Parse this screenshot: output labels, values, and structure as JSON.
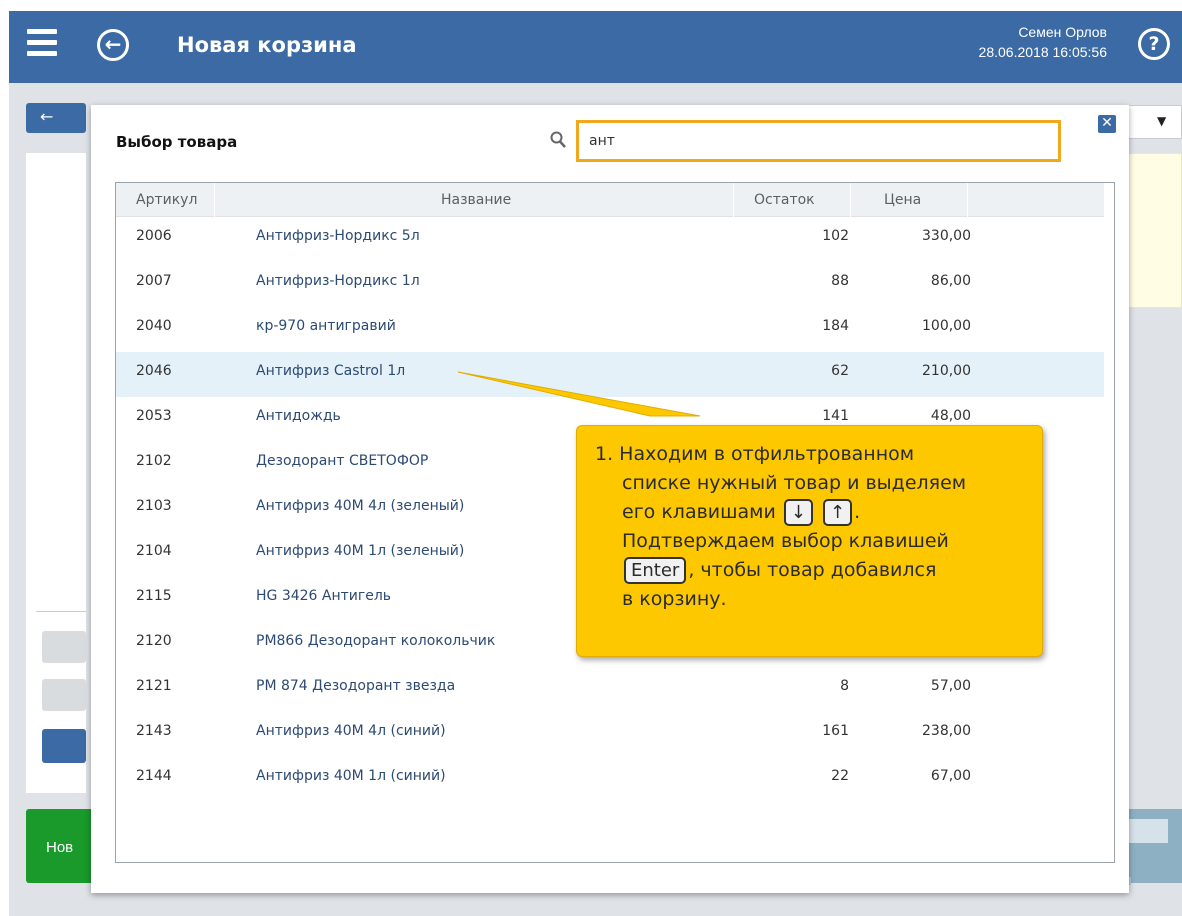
{
  "header": {
    "title": "Новая корзина",
    "user_name": "Семен Орлов",
    "datetime": "28.06.2018 16:05:56"
  },
  "background": {
    "back_arrow": "←",
    "new_button_label": "Нов"
  },
  "modal": {
    "title": "Выбор товара",
    "search_value": "ант",
    "close_label": "✕",
    "columns": {
      "article": "Артикул",
      "name": "Название",
      "stock": "Остаток",
      "price": "Цена"
    },
    "selected_article": "2046",
    "rows": [
      {
        "article": "2006",
        "name": "Антифриз-Нордикс 5л",
        "stock": "102",
        "price": "330,00"
      },
      {
        "article": "2007",
        "name": "Антифриз-Нордикс 1л",
        "stock": "88",
        "price": "86,00"
      },
      {
        "article": "2040",
        "name": "кр-970 антигравий",
        "stock": "184",
        "price": "100,00"
      },
      {
        "article": "2046",
        "name": "Антифриз Castrol 1л",
        "stock": "62",
        "price": "210,00"
      },
      {
        "article": "2053",
        "name": "Антидождь",
        "stock": "141",
        "price": "48,00"
      },
      {
        "article": "2102",
        "name": "Дезодорант СВЕТОФОР",
        "stock": "",
        "price": ""
      },
      {
        "article": "2103",
        "name": "Антифриз 40М 4л (зеленый)",
        "stock": "",
        "price": ""
      },
      {
        "article": "2104",
        "name": "Антифриз 40М 1л (зеленый)",
        "stock": "",
        "price": ""
      },
      {
        "article": "2115",
        "name": "HG 3426 Антигель",
        "stock": "",
        "price": ""
      },
      {
        "article": "2120",
        "name": "PM866 Дезодорант колокольчик",
        "stock": "",
        "price": ""
      },
      {
        "article": "2121",
        "name": "PM 874 Дезодорант звезда",
        "stock": "8",
        "price": "57,00"
      },
      {
        "article": "2143",
        "name": "Антифриз 40М 4л (синий)",
        "stock": "161",
        "price": "238,00"
      },
      {
        "article": "2144",
        "name": "Антифриз 40М 1л (синий)",
        "stock": "22",
        "price": "67,00"
      }
    ]
  },
  "callout": {
    "line1": "1. Находим в отфильтрованном",
    "line2": "списке нужный товар и выделяем",
    "line3_pre": "его клавишами",
    "key_down": "↓",
    "key_up": "↑",
    "line3_post": ".",
    "line4": "Подтверждаем выбор клавишей",
    "key_enter": "Enter",
    "line5_post": ", чтобы товар добавился",
    "line6": "в корзину."
  },
  "colors": {
    "header_bg": "#3b6aa5",
    "search_border": "#f2a81d",
    "callout_bg": "#fec800",
    "selected_row_bg": "#e5f1f8",
    "green_button": "#1a9a2b"
  },
  "icons": [
    "menu-icon",
    "back-arrow-icon",
    "help-icon",
    "search-icon",
    "close-icon"
  ]
}
